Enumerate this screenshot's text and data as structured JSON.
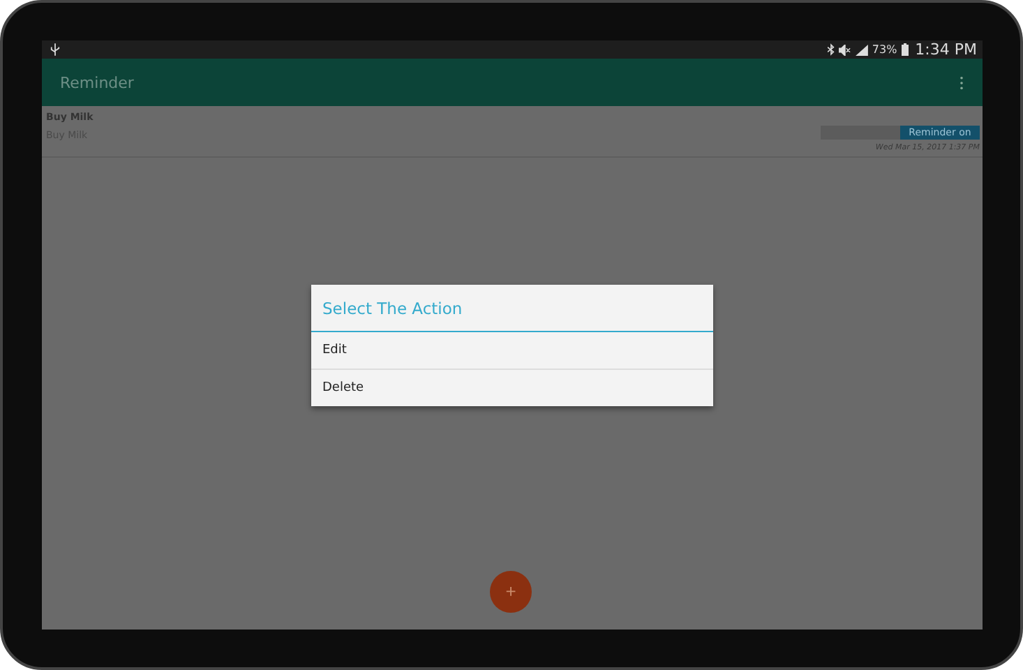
{
  "status_bar": {
    "battery": "73%",
    "time": "1:34 PM"
  },
  "app_bar": {
    "title": "Reminder"
  },
  "reminders": [
    {
      "title": "Buy Milk",
      "body": "Buy Milk",
      "toggle_label": "Reminder on",
      "reminder_on": true,
      "date": "Wed Mar 15, 2017  1:37 PM"
    }
  ],
  "dialog": {
    "title": "Select The Action",
    "options": [
      "Edit",
      "Delete"
    ]
  },
  "fab": {
    "label": "+"
  }
}
